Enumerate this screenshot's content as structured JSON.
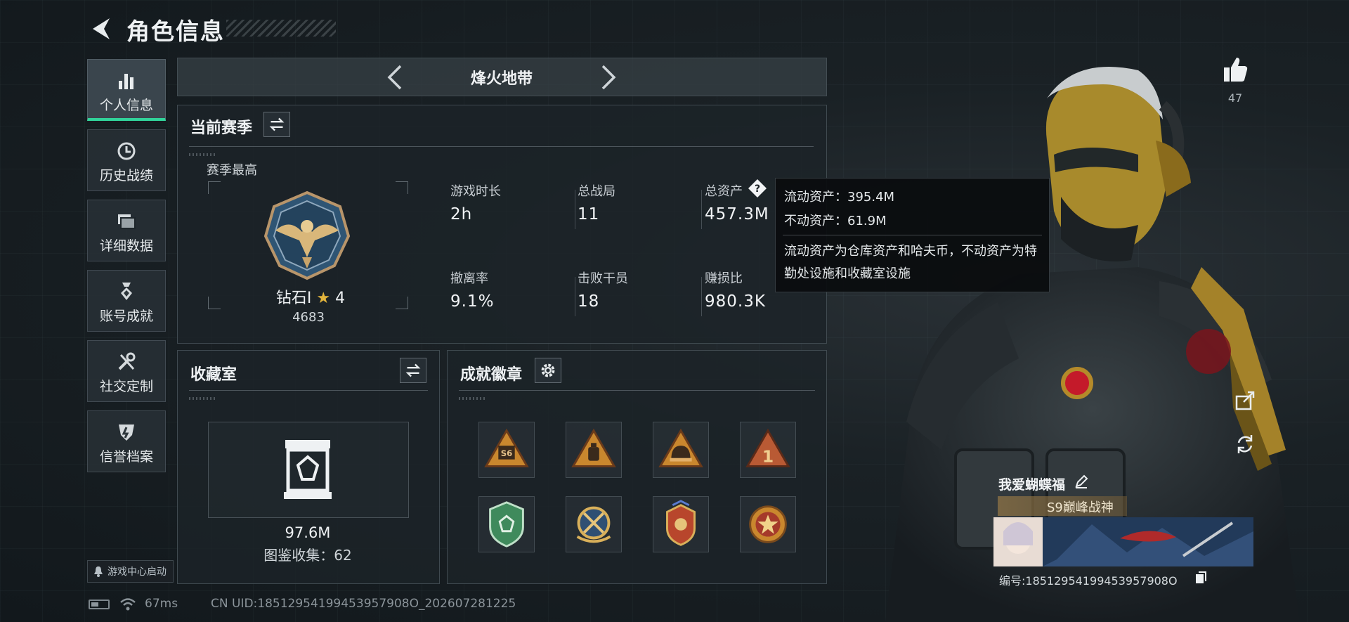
{
  "header": {
    "title": "角色信息"
  },
  "sidebar": {
    "items": [
      {
        "label": "个人信息",
        "icon": "bar-chart-icon",
        "active": true
      },
      {
        "label": "历史战绩",
        "icon": "history-clock-icon"
      },
      {
        "label": "详细数据",
        "icon": "stack-cards-icon"
      },
      {
        "label": "账号成就",
        "icon": "medal-icon"
      },
      {
        "label": "社交定制",
        "icon": "tools-icon"
      },
      {
        "label": "信誉档案",
        "icon": "shield-icon"
      }
    ],
    "launch_label": "游戏中心启动"
  },
  "status": {
    "ping": "67ms",
    "uid": "CN UID:18512954199453957908O_202607281225"
  },
  "mode": {
    "title": "烽火地带"
  },
  "season": {
    "title": "当前赛季",
    "best_label": "赛季最高",
    "rank_name": "钻石I",
    "rank_star": "★",
    "rank_stars": "4",
    "rank_score": "4683",
    "stats": [
      {
        "label": "游戏时长",
        "value": "2h"
      },
      {
        "label": "总战局",
        "value": "11"
      },
      {
        "label": "总资产",
        "value": "457.3M"
      },
      {
        "label": "撤离率",
        "value": "9.1%"
      },
      {
        "label": "击败干员",
        "value": "18"
      },
      {
        "label": "赚损比",
        "value": "980.3K"
      }
    ]
  },
  "tooltip": {
    "liquid": "流动资产：395.4M",
    "fixed": "不动资产：61.9M",
    "desc": "流动资产为仓库资产和哈夫币，不动资产为特勤处设施和收藏室设施"
  },
  "collection": {
    "title": "收藏室",
    "value": "97.6M",
    "count_text": "图鉴收集：62"
  },
  "badges": {
    "title": "成就徽章",
    "items": [
      "badge-s6-icon",
      "badge-bag-icon",
      "badge-helmet-icon",
      "badge-number-one-icon",
      "badge-green-shield-icon",
      "badge-crossed-weapons-icon",
      "badge-winged-crest-icon",
      "badge-star-icon"
    ]
  },
  "profile": {
    "likes": "47",
    "player_name": "我爱蝴蝶福",
    "title": "S9巅峰战神",
    "player_id": "编号:18512954199453957908O"
  },
  "colors": {
    "accent_green": "#31d39a",
    "gold": "#e2b43c",
    "text": "#eef1f3"
  }
}
